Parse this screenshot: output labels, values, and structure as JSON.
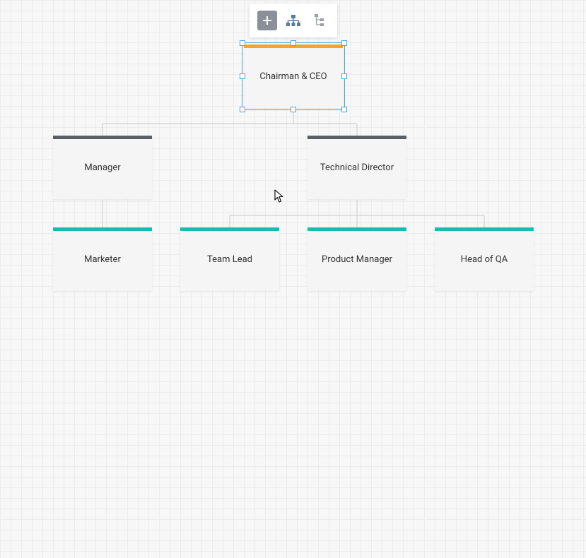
{
  "toolbar": {
    "add": "Add",
    "orgchart": "Org Chart Layout",
    "tree": "Tree Layout"
  },
  "nodes": {
    "ceo": {
      "label": "Chairman & CEO",
      "color": "#f5a623"
    },
    "manager": {
      "label": "Manager",
      "color": "#5a5f66"
    },
    "techdir": {
      "label": "Technical Director",
      "color": "#5a5f66"
    },
    "marketer": {
      "label": "Marketer",
      "color": "#15bdb1"
    },
    "teamlead": {
      "label": "Team Lead",
      "color": "#15bdb1"
    },
    "pm": {
      "label": "Product Manager",
      "color": "#15bdb1"
    },
    "qa": {
      "label": "Head of QA",
      "color": "#15bdb1"
    }
  },
  "colors": {
    "selection": "#4aa8d8",
    "canvas_bg": "#f7f7f7"
  }
}
